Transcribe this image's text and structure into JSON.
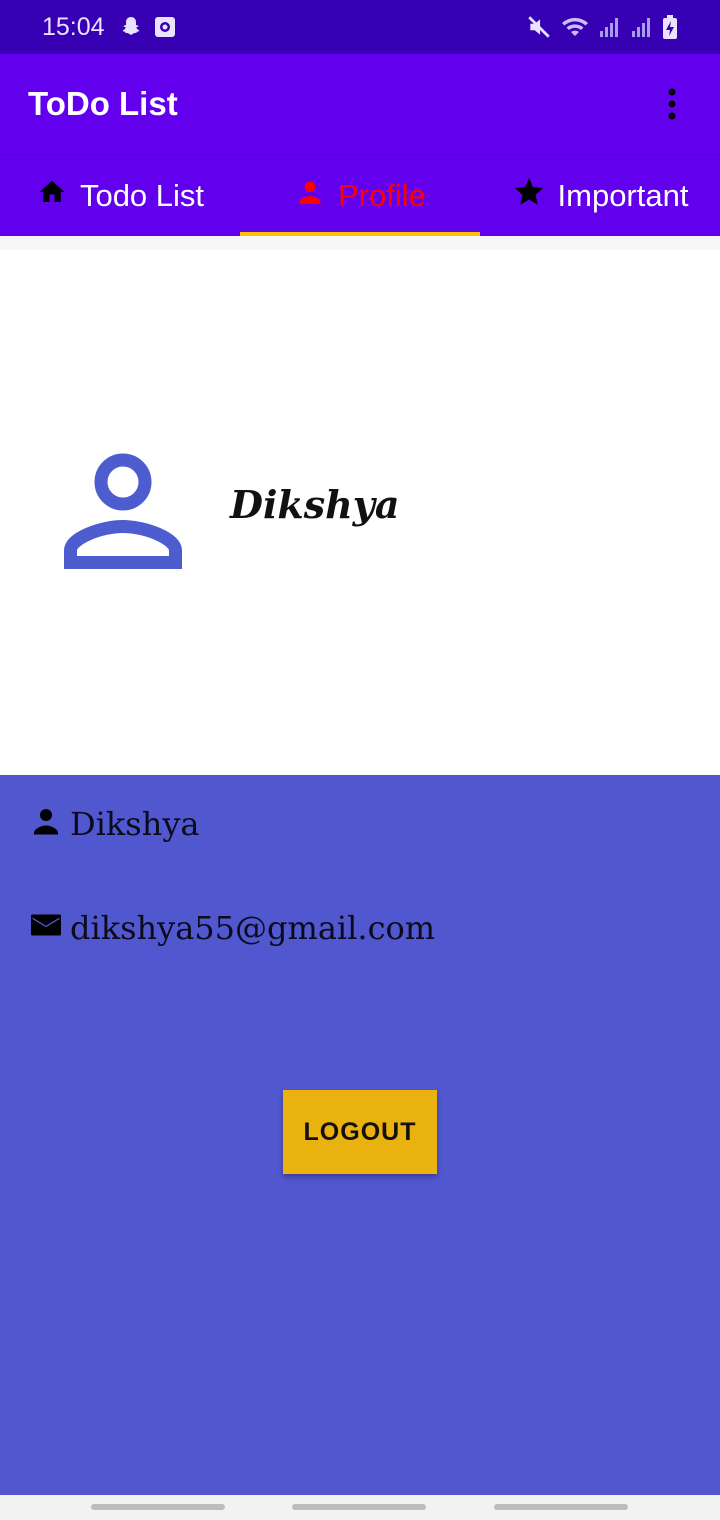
{
  "status_bar": {
    "time": "15:04",
    "left_icons": [
      "snapchat-icon",
      "camera-app-icon"
    ],
    "right_icons": [
      "mute-icon",
      "wifi-icon",
      "signal-icon",
      "signal-icon-2",
      "battery-charging-icon"
    ]
  },
  "app_bar": {
    "title": "ToDo List",
    "menu_icon": "more-vert-icon"
  },
  "tabs": [
    {
      "label": "Todo List",
      "icon": "home-icon",
      "active": false
    },
    {
      "label": "Profile",
      "icon": "person-icon",
      "active": true
    },
    {
      "label": "Important",
      "icon": "star-icon",
      "active": false
    }
  ],
  "profile": {
    "name": "Dikshya",
    "avatar_icon": "person-outline-icon"
  },
  "info": {
    "name": "Dikshya",
    "email": "dikshya55@gmail.com",
    "logout_label": "LOGOUT"
  },
  "colors": {
    "status_bar": "#3700b3",
    "primary": "#6200ee",
    "active_tab_text": "#ff0000",
    "tab_indicator": "#ffc107",
    "panel": "#5157cf",
    "avatar": "#4d5ccf",
    "logout_button": "#eab20f"
  }
}
